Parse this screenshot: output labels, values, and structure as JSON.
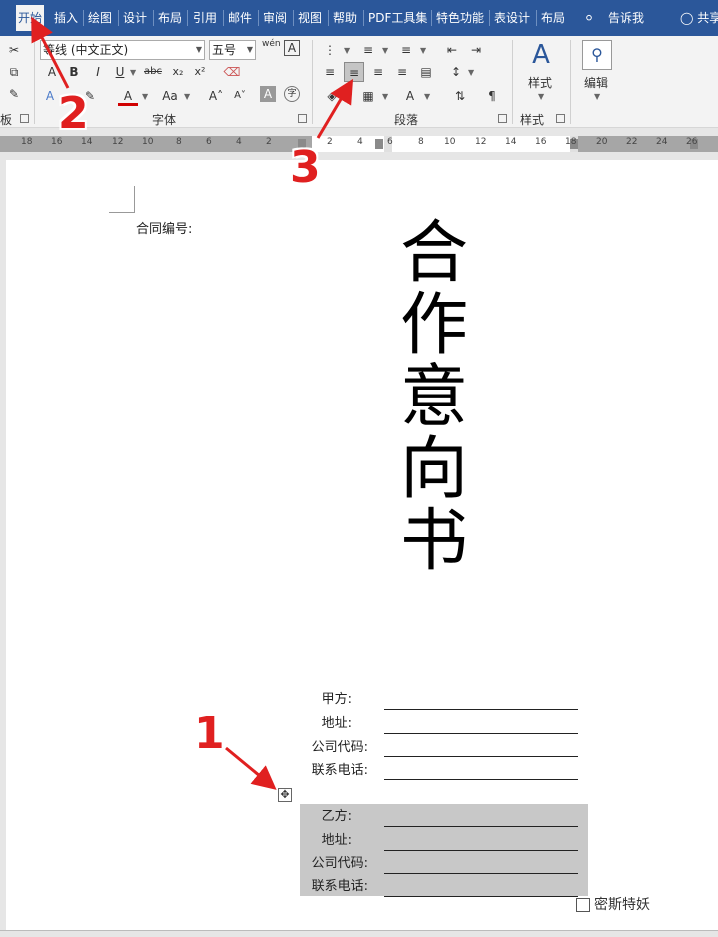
{
  "tabs": [
    "开始",
    "插入",
    "绘图",
    "设计",
    "布局",
    "引用",
    "邮件",
    "审阅",
    "视图",
    "帮助",
    "PDF工具集",
    "特色功能",
    "表设计",
    "布局"
  ],
  "tell_me": "告诉我",
  "share": "共享",
  "ribbon": {
    "font_name": "等线 (中文正文)",
    "font_size": "五号",
    "wen_label": "wén",
    "font_group": "字体",
    "paragraph_group": "段落",
    "styles_group": "样式",
    "styles_button": "样式",
    "edit_button": "编辑",
    "clipboard_group_fragment": "板",
    "bold": "B",
    "italic": "I",
    "underline": "U",
    "strike": "abc",
    "subscript": "x₂",
    "superscript": "x²",
    "font_color_a": "A",
    "aa": "Aa",
    "grow": "A˄",
    "shrink": "A˅",
    "char_border": "A",
    "phonetic": "字"
  },
  "ruler": {
    "left_ticks": [
      "18",
      "16",
      "14",
      "12",
      "10",
      "8",
      "6",
      "4",
      "2"
    ],
    "right_ticks": [
      "2",
      "4",
      "6",
      "8",
      "10",
      "12",
      "14",
      "16",
      "18",
      "20",
      "22",
      "24",
      "26"
    ]
  },
  "document": {
    "contract_no_label": "合同编号:",
    "title_chars": [
      "合",
      "作",
      "意",
      "向",
      "书"
    ],
    "party_a_fields": [
      "甲方:",
      "地址:",
      "公司代码:",
      "联系电话:"
    ],
    "party_b_fields": [
      "乙方:",
      "地址:",
      "公司代码:",
      "联系电话:"
    ],
    "table_handle_icon": "move-handle-icon"
  },
  "watermark": "密斯特妖",
  "annotations": [
    "1",
    "2",
    "3"
  ],
  "colors": {
    "tab_bar": "#2b579a",
    "annotation_red": "#e02020",
    "table_shading": "#c8c8c8"
  }
}
